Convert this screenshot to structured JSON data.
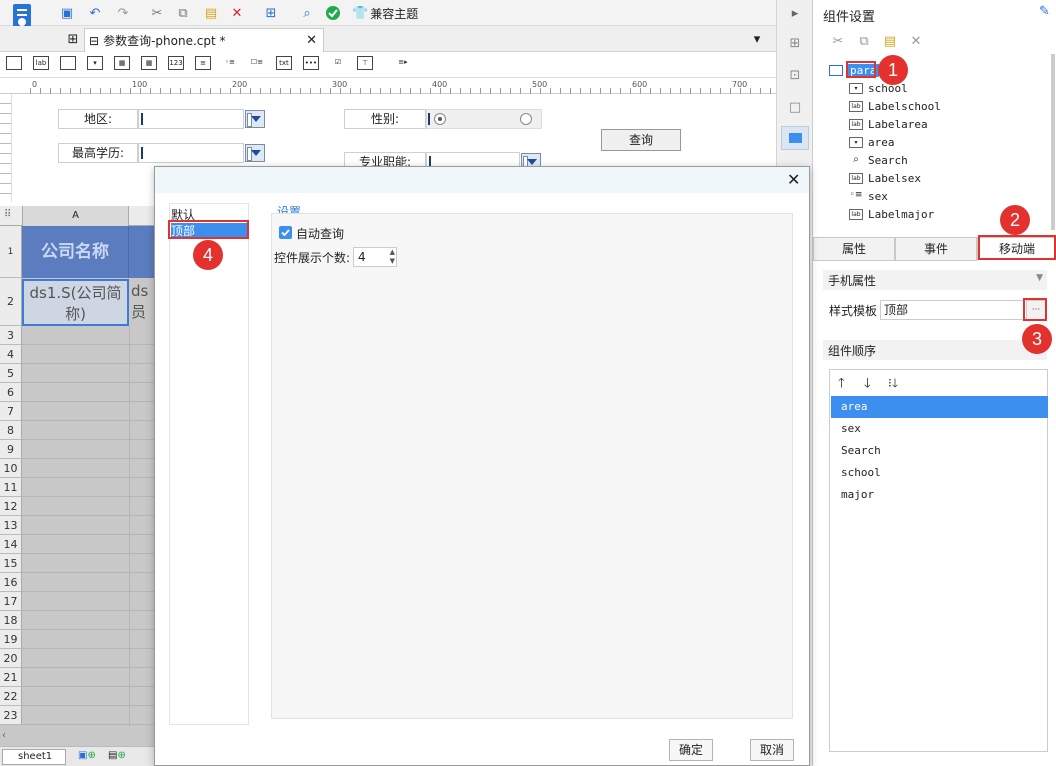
{
  "toolbar": {
    "theme_label": "兼容主题"
  },
  "editor_tab": {
    "label": "参数查询-phone.cpt *"
  },
  "ruler": {
    "marks": [
      "0",
      "100",
      "200",
      "300",
      "400",
      "500",
      "600",
      "700"
    ]
  },
  "param_panel": {
    "area_label": "地区:",
    "edu_label": "最高学历:",
    "sex_label": "性别:",
    "major_label": "专业职能:",
    "search_button": "查询"
  },
  "sheet": {
    "col_a": "A",
    "row1_num": "1 (H)",
    "header_cell": "公司名称",
    "row2_cell_a": "ds1.S(公司简称)",
    "row2_cell_b": "ds员",
    "row_numbers": [
      "2",
      "3",
      "4",
      "5",
      "6",
      "7",
      "8",
      "9",
      "10",
      "11",
      "12",
      "13",
      "14",
      "15",
      "16",
      "17",
      "18",
      "19",
      "20",
      "21",
      "22",
      "23"
    ],
    "sheet_tab": "sheet1"
  },
  "right_panel": {
    "title": "组件设置",
    "tree": [
      {
        "label": "para",
        "icon": "form-icon"
      },
      {
        "label": "school",
        "icon": "combo-icon"
      },
      {
        "label": "Labelschool",
        "icon": "label-icon"
      },
      {
        "label": "Labelarea",
        "icon": "label-icon"
      },
      {
        "label": "area",
        "icon": "combo-icon"
      },
      {
        "label": "Search",
        "icon": "search-icon"
      },
      {
        "label": "Labelsex",
        "icon": "label-icon"
      },
      {
        "label": "sex",
        "icon": "radio-icon"
      },
      {
        "label": "Labelmajor",
        "icon": "label-icon"
      }
    ],
    "tabs": [
      "属性",
      "事件",
      "移动端"
    ],
    "mobile_props_title": "手机属性",
    "style_template_label": "样式模板",
    "style_template_value": "顶部",
    "ellipsis": "···",
    "order_title": "组件顺序",
    "order_items": [
      "area",
      "sex",
      "Search",
      "school",
      "major"
    ]
  },
  "dialog": {
    "list_items": [
      "默认",
      "顶部"
    ],
    "settings_title": "设置",
    "auto_query_label": "自动查询",
    "display_count_label": "控件展示个数:",
    "display_count_value": "4",
    "ok_button": "确定",
    "cancel_button": "取消"
  },
  "badges": [
    "1",
    "2",
    "3",
    "4"
  ],
  "colors": {
    "accent": "#3d8fef",
    "badge": "#e3312e",
    "header_cell": "#5b7dbf"
  }
}
